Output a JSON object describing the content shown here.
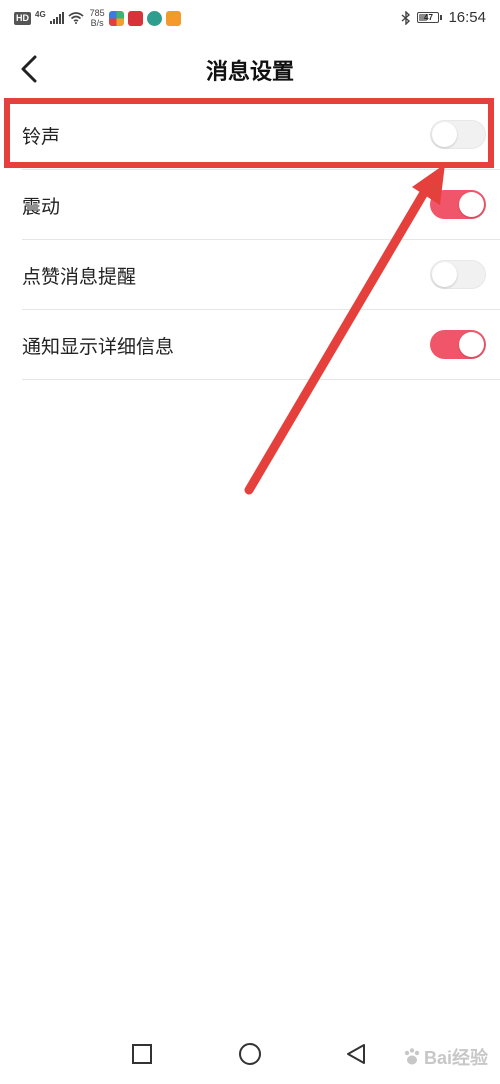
{
  "status_bar": {
    "network": "HD",
    "signal_type": "4G",
    "speed_value": "785",
    "speed_unit": "B/s",
    "battery": "47",
    "battery_level": 0.47,
    "time": "16:54"
  },
  "header": {
    "title": "消息设置",
    "back_icon": "chevron-left-icon"
  },
  "settings": [
    {
      "label": "铃声",
      "enabled": false
    },
    {
      "label": "震动",
      "enabled": true
    },
    {
      "label": "点赞消息提醒",
      "enabled": false
    },
    {
      "label": "通知显示详细信息",
      "enabled": true
    }
  ],
  "colors": {
    "toggle_on": "#f1556a",
    "toggle_off": "#f1f1f1",
    "annotation": "#e5403c"
  },
  "nav_bar": {
    "recent_icon": "square-icon",
    "home_icon": "circle-icon",
    "back_icon": "triangle-back-icon"
  },
  "watermark": {
    "text": "Bai经验"
  }
}
